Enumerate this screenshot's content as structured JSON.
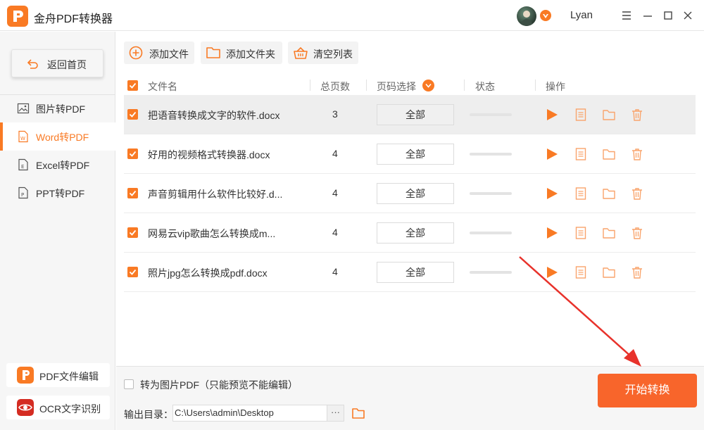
{
  "app": {
    "title": "金舟PDF转换器",
    "username": "Lyan"
  },
  "sidebar": {
    "back_label": "返回首页",
    "items": [
      {
        "label": "图片转PDF",
        "icon": "image-icon",
        "active": false
      },
      {
        "label": "Word转PDF",
        "icon": "word-icon",
        "active": true
      },
      {
        "label": "Excel转PDF",
        "icon": "excel-icon",
        "active": false
      },
      {
        "label": "PPT转PDF",
        "icon": "ppt-icon",
        "active": false
      }
    ],
    "tools": [
      {
        "label": "PDF文件编辑",
        "icon": "pdf-edit-icon"
      },
      {
        "label": "OCR文字识别",
        "icon": "ocr-eye-icon"
      }
    ]
  },
  "toolbar": {
    "add_file": "添加文件",
    "add_folder": "添加文件夹",
    "clear_list": "清空列表"
  },
  "table": {
    "headers": {
      "name": "文件名",
      "pages": "总页数",
      "page_select": "页码选择",
      "status": "状态",
      "actions": "操作"
    },
    "rows": [
      {
        "name": "把语音转换成文字的软件.docx",
        "pages": "3",
        "range": "全部",
        "selected": true
      },
      {
        "name": "好用的视频格式转换器.docx",
        "pages": "4",
        "range": "全部",
        "selected": false
      },
      {
        "name": "声音剪辑用什么软件比较好.d...",
        "pages": "4",
        "range": "全部",
        "selected": false
      },
      {
        "name": "网易云vip歌曲怎么转换成m...",
        "pages": "4",
        "range": "全部",
        "selected": false
      },
      {
        "name": "照片jpg怎么转换成pdf.docx",
        "pages": "4",
        "range": "全部",
        "selected": false
      }
    ]
  },
  "bottom": {
    "to_image_pdf": "转为图片PDF（只能预览不能编辑）",
    "output_label": "输出目录：",
    "output_path": "C:\\Users\\admin\\Desktop",
    "more": "···",
    "start": "开始转换"
  },
  "colors": {
    "accent": "#f97a24",
    "start": "#f8652b",
    "arrow": "#e8322b"
  }
}
